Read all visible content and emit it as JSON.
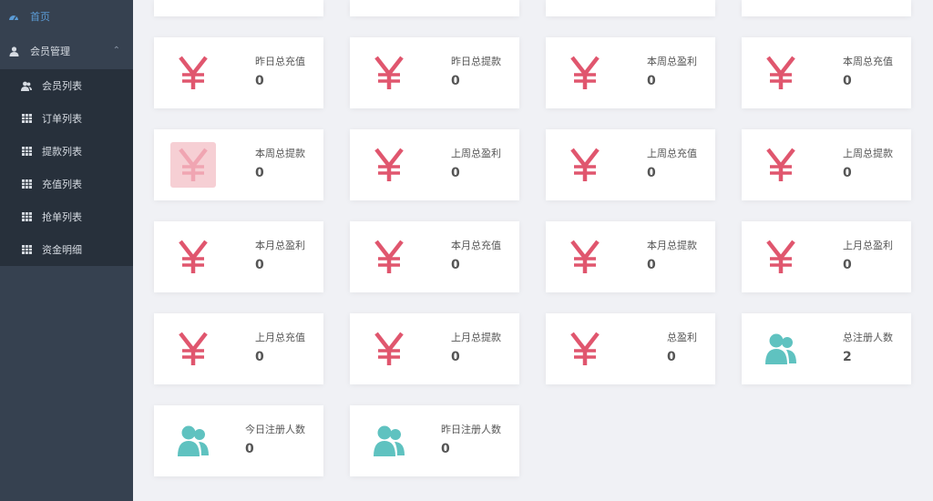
{
  "sidebar": {
    "home_label": "首页",
    "group_label": "会员管理",
    "items": [
      {
        "label": "会员列表",
        "icon": "users-icon"
      },
      {
        "label": "订单列表",
        "icon": "grid-icon"
      },
      {
        "label": "提款列表",
        "icon": "grid-icon"
      },
      {
        "label": "充值列表",
        "icon": "grid-icon"
      },
      {
        "label": "抢单列表",
        "icon": "grid-icon"
      },
      {
        "label": "资金明细",
        "icon": "grid-icon"
      }
    ]
  },
  "colors": {
    "yen": "#e0566e",
    "user": "#5fc2c0",
    "sidebar_bg": "#364150",
    "subnav_bg": "#27303b",
    "home": "#5b9bd5"
  },
  "cards": [
    {
      "label": "昨日总充值",
      "value": "0",
      "icon": "yen-icon"
    },
    {
      "label": "昨日总提款",
      "value": "0",
      "icon": "yen-icon"
    },
    {
      "label": "本周总盈利",
      "value": "0",
      "icon": "yen-icon"
    },
    {
      "label": "本周总充值",
      "value": "0",
      "icon": "yen-icon"
    },
    {
      "label": "本周总提款",
      "value": "0",
      "icon": "yen-icon",
      "highlight": true
    },
    {
      "label": "上周总盈利",
      "value": "0",
      "icon": "yen-icon"
    },
    {
      "label": "上周总充值",
      "value": "0",
      "icon": "yen-icon"
    },
    {
      "label": "上周总提款",
      "value": "0",
      "icon": "yen-icon"
    },
    {
      "label": "本月总盈利",
      "value": "0",
      "icon": "yen-icon"
    },
    {
      "label": "本月总充值",
      "value": "0",
      "icon": "yen-icon"
    },
    {
      "label": "本月总提款",
      "value": "0",
      "icon": "yen-icon"
    },
    {
      "label": "上月总盈利",
      "value": "0",
      "icon": "yen-icon"
    },
    {
      "label": "上月总充值",
      "value": "0",
      "icon": "yen-icon"
    },
    {
      "label": "上月总提款",
      "value": "0",
      "icon": "yen-icon"
    },
    {
      "label": "总盈利",
      "value": "0",
      "icon": "yen-icon"
    },
    {
      "label": "总注册人数",
      "value": "2",
      "icon": "users-icon"
    },
    {
      "label": "今日注册人数",
      "value": "0",
      "icon": "users-icon"
    },
    {
      "label": "昨日注册人数",
      "value": "0",
      "icon": "users-icon"
    }
  ]
}
